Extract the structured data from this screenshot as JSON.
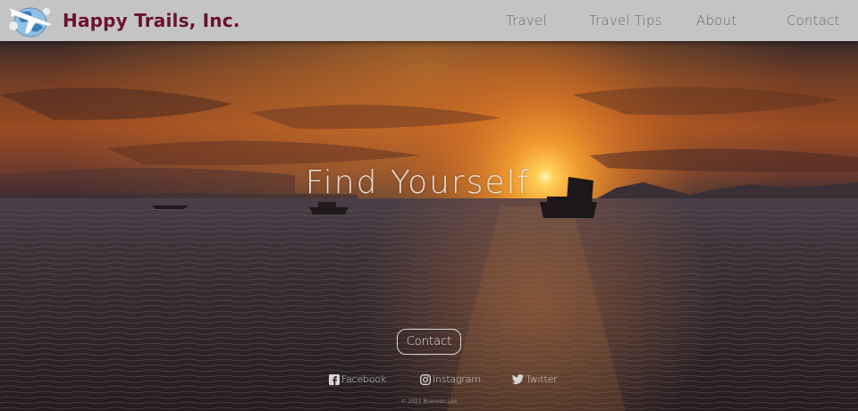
{
  "brand": {
    "name": "Happy Trails, Inc.",
    "logo_icon": "globe-airplane-icon",
    "color": "#6a1230"
  },
  "nav": {
    "items": [
      {
        "label": "Travel"
      },
      {
        "label": "Travel Tips"
      },
      {
        "label": "About"
      },
      {
        "label": "Contact"
      }
    ]
  },
  "hero": {
    "headline": "Find Yourself",
    "contact_button": "Contact"
  },
  "social": [
    {
      "label": "Facebook",
      "icon": "facebook-icon"
    },
    {
      "label": "Instagram",
      "icon": "instagram-icon"
    },
    {
      "label": "Twitter",
      "icon": "twitter-icon"
    }
  ],
  "footer": {
    "copyright": "© 2021 Brannon Lee"
  },
  "colors": {
    "navbar_bg": "#c4c4c4",
    "nav_text": "#6d6d6d",
    "sky_glow": "#f39a2a",
    "sea": "#2b2227"
  }
}
